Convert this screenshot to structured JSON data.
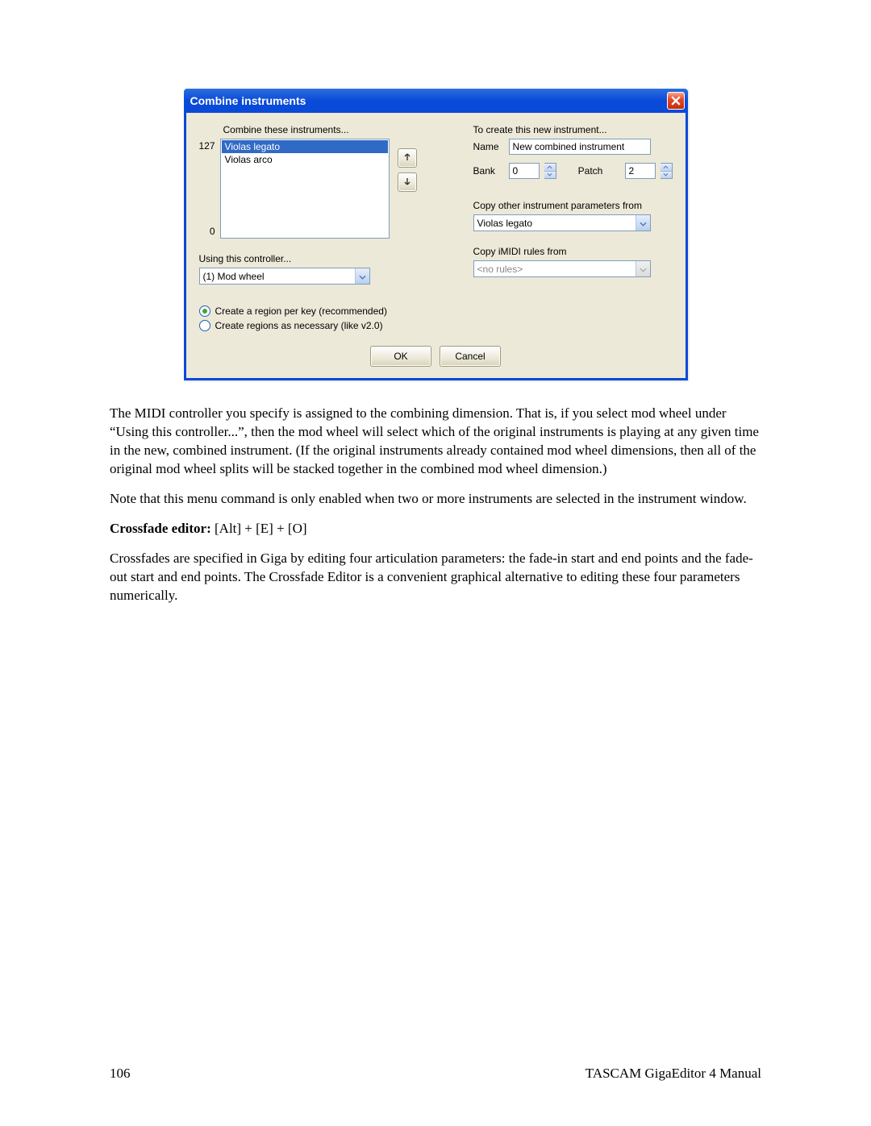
{
  "dialog": {
    "title": "Combine instruments",
    "left": {
      "combine_label": "Combine these instruments...",
      "range_top": "127",
      "range_bottom": "0",
      "items": [
        "Violas legato",
        "Violas arco"
      ],
      "selected_index": 0,
      "controller_label": "Using this controller...",
      "controller_value": "(1) Mod wheel",
      "radio1": "Create a region per key (recommended)",
      "radio2": "Create regions as necessary (like v2.0)"
    },
    "right": {
      "create_label": "To create this new instrument...",
      "name_label": "Name",
      "name_value": "New combined instrument",
      "bank_label": "Bank",
      "bank_value": "0",
      "patch_label": "Patch",
      "patch_value": "2",
      "copy_params_label": "Copy other instrument parameters from",
      "copy_params_value": "Violas legato",
      "copy_imidi_label": "Copy iMIDI rules from",
      "copy_imidi_value": "<no rules>"
    },
    "ok": "OK",
    "cancel": "Cancel"
  },
  "doc": {
    "p1": "The MIDI controller you specify is assigned to the combining dimension.  That is, if you select mod wheel under “Using this controller...”, then the mod wheel will select which of the original instruments is playing at any given time in the new, combined instrument.  (If the original instruments already contained mod wheel dimensions, then all of the original mod wheel splits will be stacked together in the combined mod wheel dimension.)",
    "p2": "Note that this menu command is only enabled when two or more instruments are selected in the instrument window.",
    "p3_bold": "Crossfade editor:",
    "p3_rest": " [Alt] + [E] + [O]",
    "p4": "Crossfades are specified in Giga by editing four articulation parameters: the fade-in start and end points and the fade-out start and end points. The Crossfade Editor is a convenient graphical alternative to editing these four parameters numerically."
  },
  "footer": {
    "page": "106",
    "title": "TASCAM GigaEditor 4 Manual"
  }
}
